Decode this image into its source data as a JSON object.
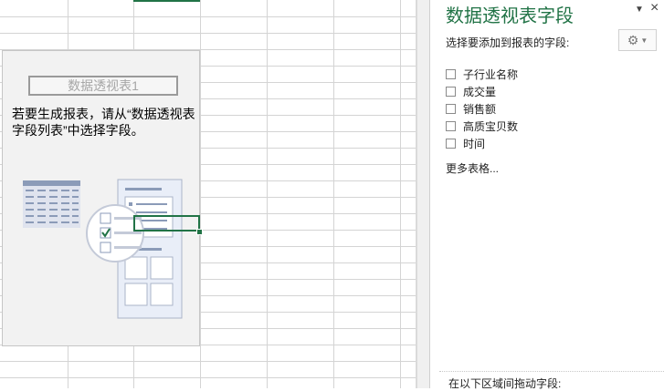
{
  "pivot": {
    "table_name": "数据透视表1",
    "hint": "若要生成报表，请从“数据透视表字段列表”中选择字段。"
  },
  "pane": {
    "title": "数据透视表字段",
    "subtitle": "选择要添加到报表的字段:",
    "fields": [
      {
        "label": "子行业名称",
        "checked": false
      },
      {
        "label": "成交量",
        "checked": false
      },
      {
        "label": "销售额",
        "checked": false
      },
      {
        "label": "高质宝贝数",
        "checked": false
      },
      {
        "label": "时间",
        "checked": false
      }
    ],
    "more_tables": "更多表格...",
    "drag_hint": "在以下区域间拖动字段:"
  },
  "icons": {
    "tools": "gear-icon",
    "pane_options": "chevron-down-icon",
    "close": "close-icon"
  },
  "colors": {
    "accent": "#217346",
    "pivot_bg": "#f2f2f2",
    "grid_line": "#d4d4d4"
  }
}
